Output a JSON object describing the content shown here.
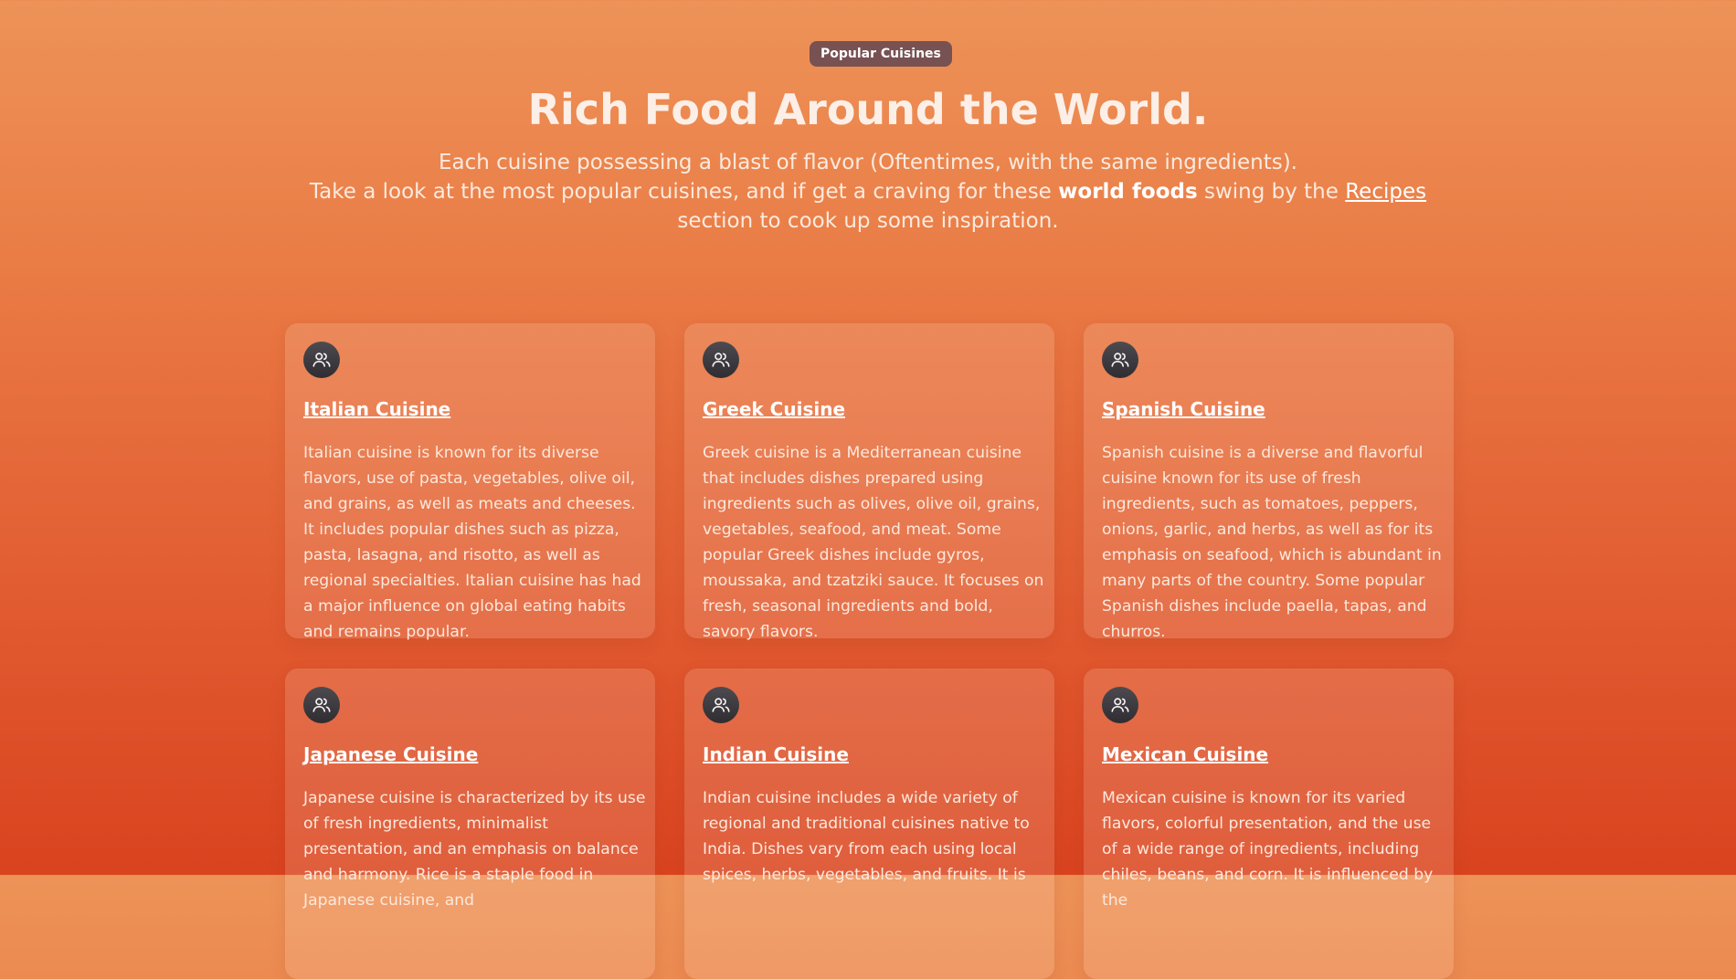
{
  "header": {
    "badge": "Popular Cuisines",
    "title": "Rich Food Around the World.",
    "subtitle_line1": "Each cuisine possessing a blast of flavor (Oftentimes, with the same ingredients).",
    "subtitle_part1": "Take a look at the most popular cuisines, and if get a craving for these ",
    "subtitle_emphasis": "world foods",
    "subtitle_part2": " swing by the ",
    "subtitle_link": "Recipes",
    "subtitle_part3": " section to cook up some inspiration."
  },
  "cards": [
    {
      "icon": "users-icon",
      "title": "Italian Cuisine",
      "text": "Italian cuisine is known for its diverse flavors, use of pasta, vegetables, olive oil, and grains, as well as meats and cheeses. It includes popular dishes such as pizza, pasta, lasagna, and risotto, as well as regional specialties. Italian cuisine has had a major influence on global eating habits and remains popular."
    },
    {
      "icon": "users-icon",
      "title": "Greek Cuisine",
      "text": "Greek cuisine is a Mediterranean cuisine that includes dishes prepared using ingredients such as olives, olive oil, grains, vegetables, seafood, and meat. Some popular Greek dishes include gyros, moussaka, and tzatziki sauce. It focuses on fresh, seasonal ingredients and bold, savory flavors."
    },
    {
      "icon": "users-icon",
      "title": "Spanish Cuisine",
      "text": "Spanish cuisine is a diverse and flavorful cuisine known for its use of fresh ingredients, such as tomatoes, peppers, onions, garlic, and herbs, as well as for its emphasis on seafood, which is abundant in many parts of the country. Some popular Spanish dishes include paella, tapas, and churros."
    },
    {
      "icon": "users-icon",
      "title": "Japanese Cuisine",
      "text": "Japanese cuisine is characterized by its use of fresh ingredients, minimalist presentation, and an emphasis on balance and harmony. Rice is a staple food in Japanese cuisine, and"
    },
    {
      "icon": "users-icon",
      "title": "Indian Cuisine",
      "text": "Indian cuisine includes a wide variety of regional and traditional cuisines native to India. Dishes vary from each using local spices, herbs, vegetables, and fruits. It is"
    },
    {
      "icon": "users-icon",
      "title": "Mexican Cuisine",
      "text": "Mexican cuisine is known for its varied flavors, colorful presentation, and the use of a wide range of ingredients, including chiles, beans, and corn. It is influenced by the"
    }
  ]
}
